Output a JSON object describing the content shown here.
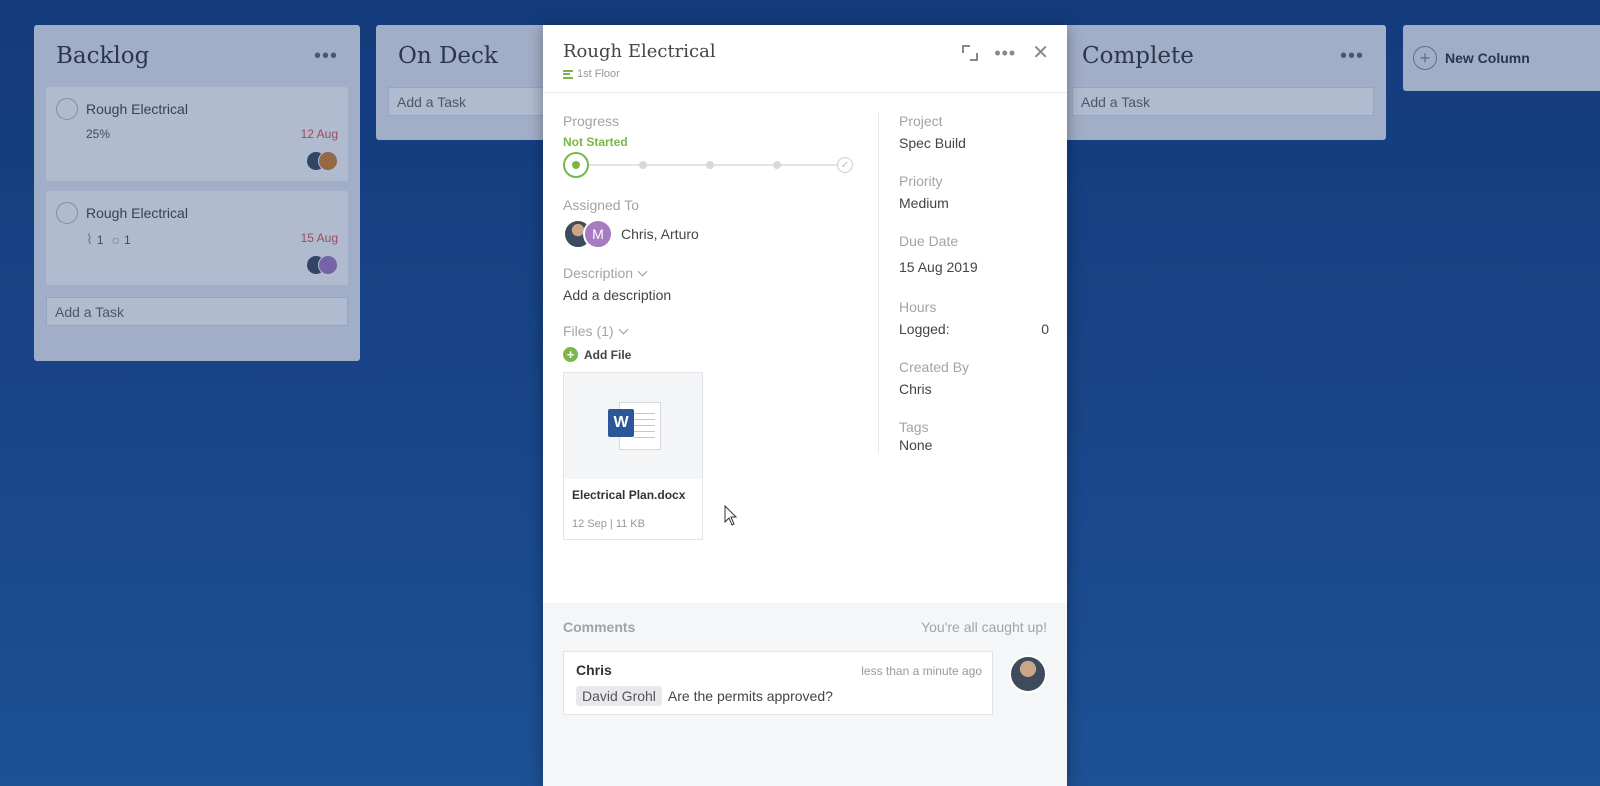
{
  "board": {
    "columns": [
      {
        "title": "Backlog",
        "add_task": "Add a Task",
        "tasks": [
          {
            "title": "Rough Electrical",
            "meta": "25%",
            "due": "12 Aug"
          },
          {
            "title": "Rough Electrical",
            "attachments": "1",
            "comments": "1",
            "due": "15 Aug"
          }
        ]
      },
      {
        "title": "On Deck",
        "add_task": "Add a Task"
      },
      {
        "title": "Complete",
        "add_task": "Add a Task"
      }
    ],
    "new_column": "New Column"
  },
  "modal": {
    "title": "Rough Electrical",
    "subtitle": "1st Floor",
    "progress_label": "Progress",
    "progress_status": "Not Started",
    "progress_steps": 5,
    "progress_current": 0,
    "assigned_label": "Assigned To",
    "assigned_names": "Chris, Arturo",
    "avatar_arturo_initial": "M",
    "description_label": "Description",
    "description_placeholder": "Add a description",
    "files_label": "Files (1)",
    "add_file": "Add File",
    "file": {
      "name": "Electrical Plan.docx",
      "meta": "12 Sep | 11 KB",
      "badge": "W"
    },
    "project_label": "Project",
    "project_value": "Spec Build",
    "priority_label": "Priority",
    "priority_value": "Medium",
    "due_label": "Due Date",
    "due_value": "15 Aug 2019",
    "hours_label": "Hours",
    "logged_label": "Logged:",
    "logged_value": "0",
    "created_label": "Created By",
    "created_value": "Chris",
    "tags_label": "Tags",
    "tags_value": "None"
  },
  "comments": {
    "title": "Comments",
    "status": "You're all caught up!",
    "items": [
      {
        "author": "Chris",
        "time": "less than a minute ago",
        "mention": "David Grohl",
        "text": "Are the permits approved?"
      }
    ]
  },
  "colors": {
    "accent_green": "#7ab648",
    "due_red": "#e0564a",
    "word_blue": "#2b579a"
  }
}
